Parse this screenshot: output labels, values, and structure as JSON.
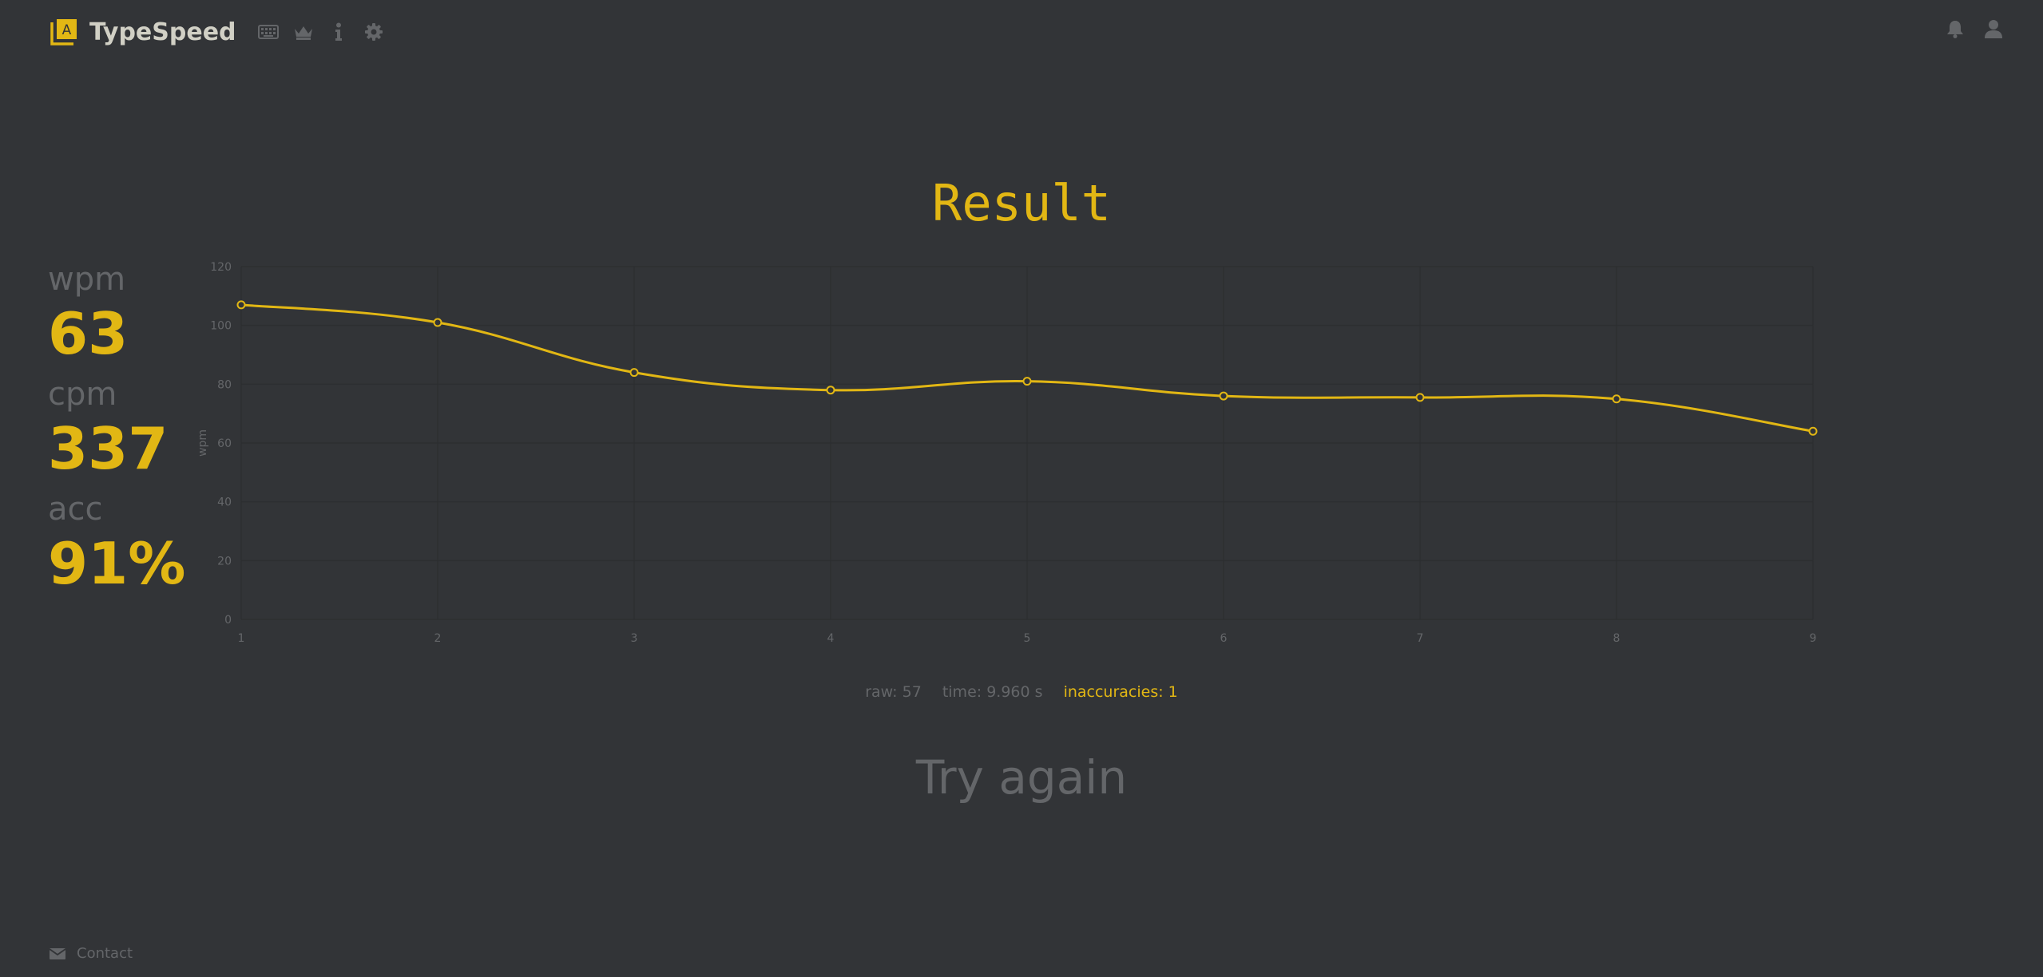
{
  "header": {
    "brand": "TypeSpeed",
    "logo_letter": "A",
    "nav_icons": [
      "keyboard-icon",
      "crown-icon",
      "info-icon",
      "gear-icon"
    ],
    "right_icons": [
      "bell-icon",
      "user-icon"
    ]
  },
  "result": {
    "title": "Result"
  },
  "stats": {
    "wpm_label": "wpm",
    "wpm_value": "63",
    "cpm_label": "cpm",
    "cpm_value": "337",
    "acc_label": "acc",
    "acc_value": "91%"
  },
  "details": {
    "raw": "raw: 57",
    "time": "time: 9.960 s",
    "inaccuracies": "inaccuracies: 1"
  },
  "try_again": "Try again",
  "footer": {
    "contact": "Contact"
  },
  "colors": {
    "background": "#323437",
    "accent": "#e2b714",
    "muted": "#646669",
    "text": "#d1d0c5"
  },
  "chart_data": {
    "type": "line",
    "x": [
      1,
      2,
      3,
      4,
      5,
      6,
      7,
      8,
      9
    ],
    "series": [
      {
        "values": [
          107,
          101,
          84,
          78,
          81,
          76,
          75.5,
          75,
          64
        ]
      }
    ],
    "ylabel": "wpm",
    "ylim": [
      0,
      120
    ],
    "yticks": [
      0,
      20,
      40,
      60,
      80,
      100,
      120
    ],
    "grid": true,
    "smooth": true
  }
}
